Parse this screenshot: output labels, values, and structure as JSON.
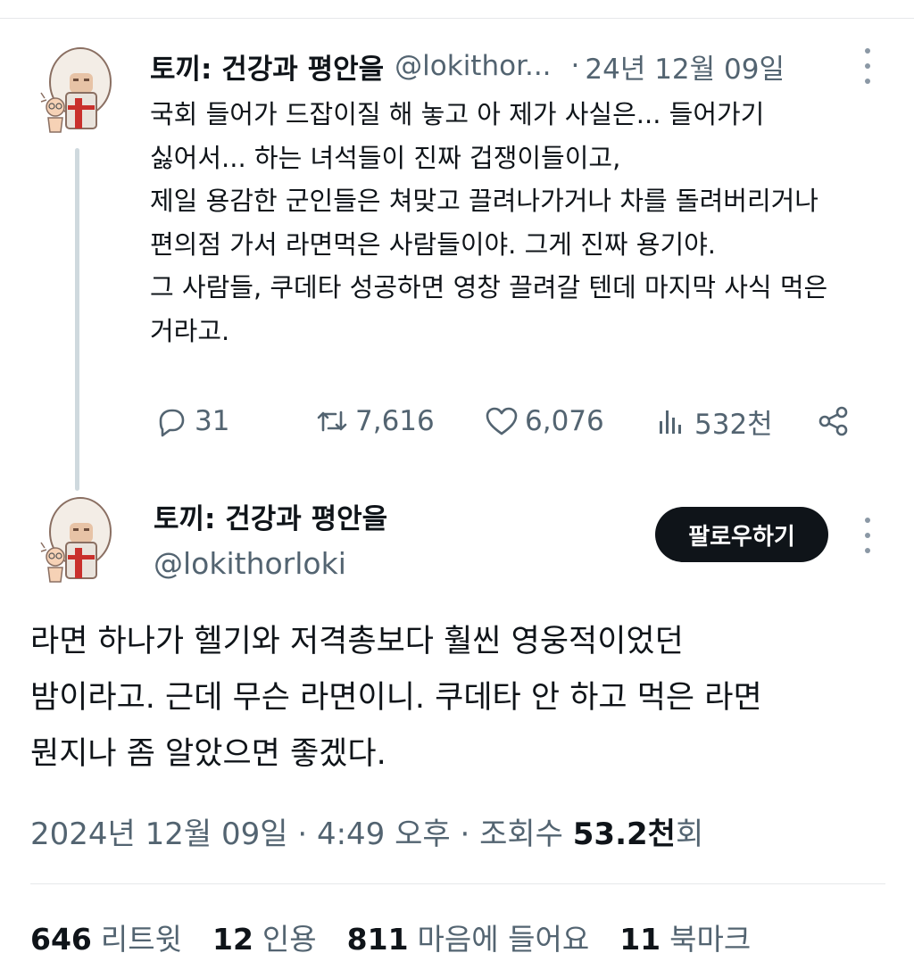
{
  "parent_tweet": {
    "author_name": "토끼: 건강과 평안을",
    "handle": "@lokithor...",
    "separator": "·",
    "date": "24년 12월 09일",
    "lines": [
      "국회 들어가 드잡이질 해 놓고 아 제가 사실은... 들어가기",
      "싫어서... 하는 녀석들이 진짜 겁쟁이들이고,",
      "제일 용감한 군인들은 쳐맞고 끌려나가거나 차를 돌려버리거나",
      "편의점 가서 라면먹은 사람들이야. 그게 진짜 용기야.",
      "그 사람들, 쿠데타 성공하면 영창 끌려갈 텐데 마지막 사식 먹은",
      "거라고."
    ],
    "actions": {
      "reply_icon": "reply-icon",
      "replies": "31",
      "retweet_icon": "retweet-icon",
      "retweets": "7,616",
      "like_icon": "heart-icon",
      "likes": "6,076",
      "views_icon": "views-icon",
      "views": "532천",
      "share_icon": "share-icon"
    }
  },
  "main_tweet": {
    "author_name": "토끼: 건강과 평안을",
    "handle": "@lokithorloki",
    "follow_label": "팔로우하기",
    "lines": [
      "라면 하나가 헬기와 저격총보다 훨씬 영웅적이었던",
      "밤이라고. 근데 무슨 라면이니. 쿠데타 안 하고 먹은 라면",
      "뭔지나 좀 알았으면 좋겠다."
    ],
    "meta": {
      "date": "2024년 12월 09일",
      "sep1": "·",
      "time": "4:49 오후",
      "sep2": "·",
      "views_label": "조회수",
      "views_value": "53.2천",
      "views_suffix": "회"
    },
    "stats": [
      {
        "value": "646",
        "label": "리트윗"
      },
      {
        "value": "12",
        "label": "인용"
      },
      {
        "value": "811",
        "label": "마음에 들어요"
      },
      {
        "value": "11",
        "label": "북마크"
      }
    ]
  },
  "colors": {
    "text_primary": "#0f1419",
    "text_secondary": "#536471",
    "thread_line": "#cfd9de",
    "follow_button_bg": "#0f1419"
  }
}
